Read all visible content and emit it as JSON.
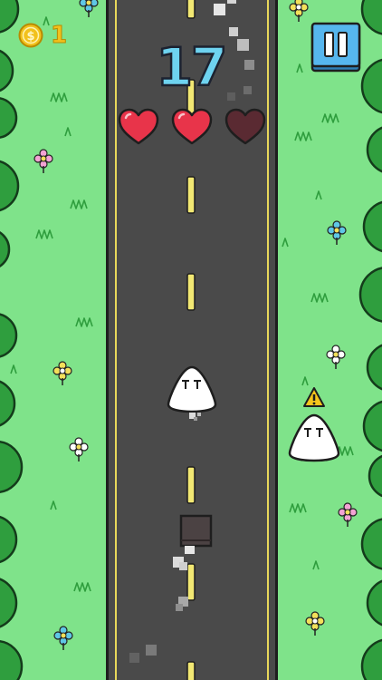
{
  "hud": {
    "coins": "1",
    "score": "17",
    "lives": [
      {
        "state": "full",
        "color": "#e8344a"
      },
      {
        "state": "full",
        "color": "#e8344a"
      },
      {
        "state": "empty",
        "color": "#5a2a32"
      }
    ]
  },
  "icons": {
    "coin": "coin-icon",
    "pause": "pause-icon",
    "heart": "heart-icon",
    "warning": "warning-icon",
    "flower": "flower-icon",
    "bush": "bush-icon",
    "grass": "grass-tuft-icon",
    "player": "player-blob-icon",
    "enemy": "enemy-blob-icon",
    "obstacle": "crate-icon"
  },
  "colors": {
    "grass": "#7fe38a",
    "road": "#4a4a4a",
    "road_edge": "#e8d75a",
    "lane_dash": "#f2e873",
    "bush": "#2f9e3e",
    "score_fill": "#6ed3f0",
    "pause_button": "#56b6ee",
    "coin": "#f2c11d",
    "warning": "#f5c51b"
  }
}
